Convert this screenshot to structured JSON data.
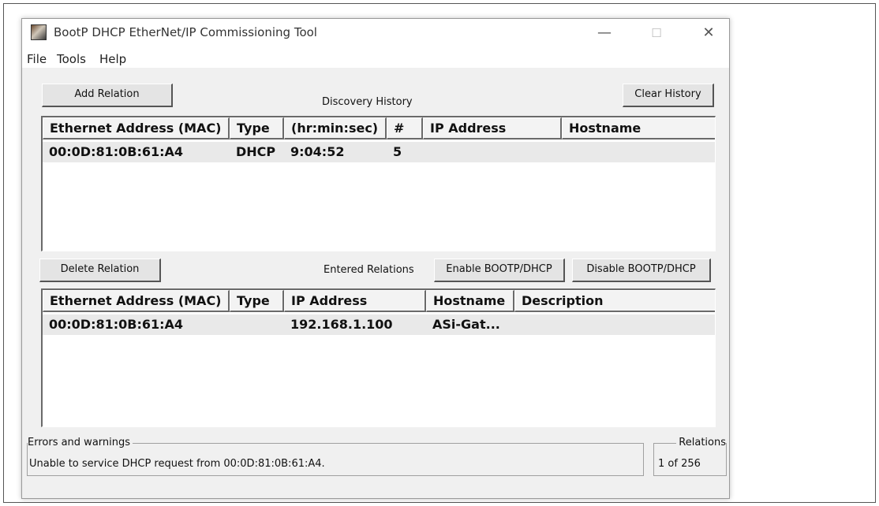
{
  "window": {
    "title": "BootP DHCP EtherNet/IP Commissioning Tool",
    "controls": {
      "minimize": "—",
      "maximize": "☐",
      "close": "✕"
    }
  },
  "menu": [
    "File",
    "Tools",
    "Help"
  ],
  "discovery": {
    "add_button": "Add Relation",
    "caption": "Discovery History",
    "clear_button": "Clear History",
    "columns": [
      "Ethernet Address (MAC)",
      "Type",
      "(hr:min:sec)",
      "#",
      "IP Address",
      "Hostname"
    ],
    "rows": [
      {
        "mac": "00:0D:81:0B:61:A4",
        "type": "DHCP",
        "time": "9:04:52",
        "count": "5",
        "ip": "",
        "hostname": ""
      }
    ]
  },
  "relations": {
    "delete_button": "Delete Relation",
    "caption": "Entered Relations",
    "enable_button": "Enable BOOTP/DHCP",
    "disable_button": "Disable BOOTP/DHCP",
    "columns": [
      "Ethernet Address (MAC)",
      "Type",
      "IP Address",
      "Hostname",
      "Description"
    ],
    "rows": [
      {
        "mac": "00:0D:81:0B:61:A4",
        "type": "",
        "ip": "192.168.1.100",
        "hostname": "ASi-Gat...",
        "description": ""
      }
    ]
  },
  "status": {
    "errors_label": "Errors and warnings",
    "errors_text": "Unable to service DHCP request from 00:0D:81:0B:61:A4.",
    "relations_label": "Relations",
    "relations_count": "1 of 256"
  }
}
